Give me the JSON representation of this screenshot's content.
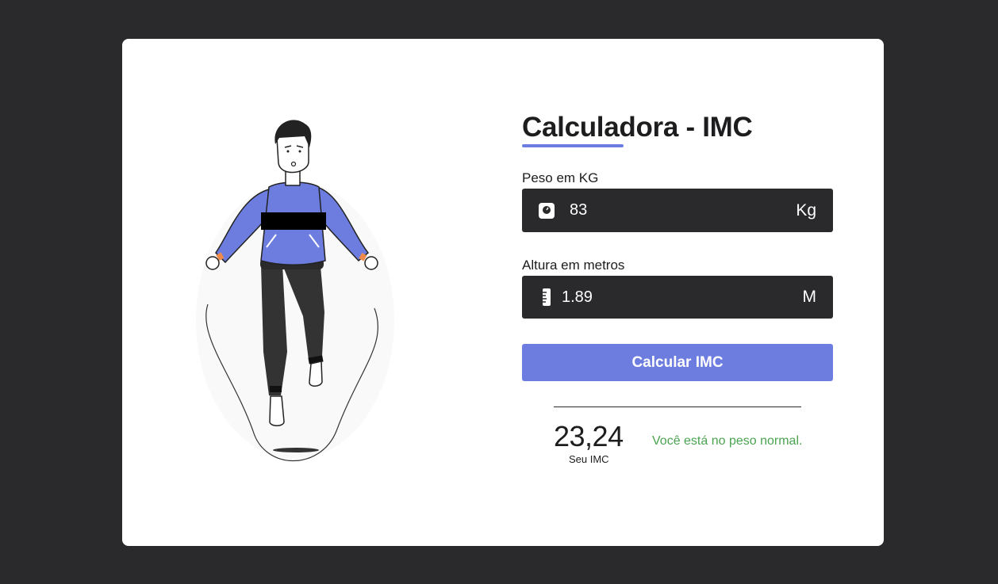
{
  "app": {
    "title": "Calculadora - IMC"
  },
  "colors": {
    "accent": "#6d7ddf",
    "background": "#2a2a2c",
    "card": "#ffffff",
    "success": "#4aa351"
  },
  "form": {
    "weight": {
      "label": "Peso em KG",
      "value": "83",
      "unit": "Kg",
      "icon": "scale-icon"
    },
    "height": {
      "label": "Altura em metros",
      "value": "1.89",
      "unit": "M",
      "icon": "ruler-icon"
    },
    "submit_label": "Calcular IMC"
  },
  "result": {
    "value": "23,24",
    "caption": "Seu IMC",
    "message": "Você está no peso normal."
  },
  "illustration": {
    "name": "jump-rope-person"
  }
}
